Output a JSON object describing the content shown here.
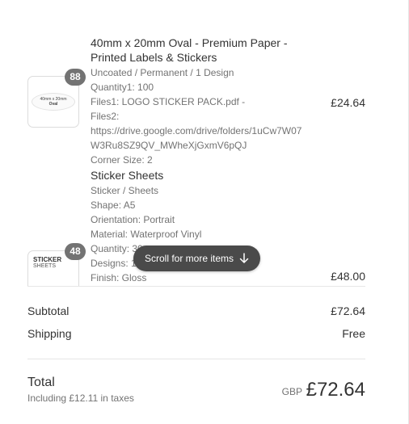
{
  "items": [
    {
      "quantity_badge": "88",
      "thumbnail": {
        "line1": "40mm x 20mm",
        "line2": "Oval"
      },
      "title": "40mm x 20mm Oval - Premium Paper - Printed Labels & Stickers",
      "properties": [
        "Uncoated / Permanent / 1 Design",
        "Quantity1: 100",
        "Files1: LOGO STICKER PACK.pdf -",
        "Files2:",
        "https://drive.google.com/drive/folders/1uCw7W07W3Ru8SZ9QV_MWheXjGxmV6pQJ",
        "Corner Size: 2"
      ],
      "price": "£24.64"
    },
    {
      "quantity_badge": "48",
      "thumbnail": {
        "line1": "STICKER",
        "line2": "SHEETS"
      },
      "title": "Sticker Sheets",
      "properties": [
        "Sticker / Sheets",
        "Shape: A5",
        "Orientation: Portrait",
        "Material: Waterproof Vinyl",
        "Quantity: 30",
        "Designs: 1",
        "Finish: Gloss"
      ],
      "price": "£48.00"
    }
  ],
  "scroll_hint": {
    "label": "Scroll for more items",
    "icon": "arrow-down-icon"
  },
  "summary": {
    "subtotal_label": "Subtotal",
    "subtotal_value": "£72.64",
    "shipping_label": "Shipping",
    "shipping_value": "Free"
  },
  "total": {
    "label": "Total",
    "taxes_note": "Including £12.11 in taxes",
    "currency": "GBP",
    "amount": "£72.64"
  },
  "colors": {
    "text": "#333333",
    "muted": "#737373",
    "badge": "#737373",
    "pill": "#4a4a4a",
    "border": "#e6e6e6"
  }
}
